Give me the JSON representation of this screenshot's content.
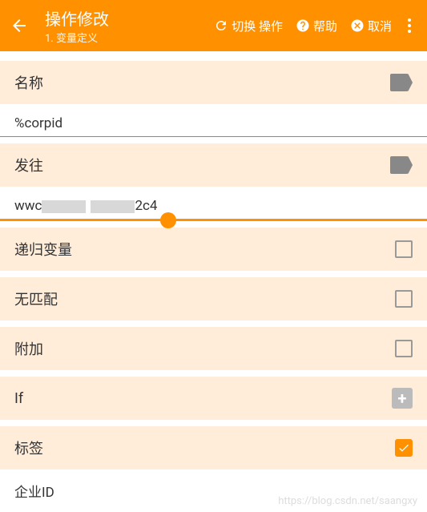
{
  "header": {
    "title": "操作修改",
    "subtitle": "1. 变量定义",
    "switch_action": "切换 操作",
    "help": "帮助",
    "cancel": "取消"
  },
  "sections": {
    "name": {
      "label": "名称",
      "value": "%corpid"
    },
    "to": {
      "label": "发往",
      "value_prefix": "wwc",
      "value_suffix": "2c4"
    },
    "recursive": {
      "label": "递归变量"
    },
    "nomatch": {
      "label": "无匹配"
    },
    "append": {
      "label": "附加"
    },
    "if": {
      "label": "If"
    },
    "tag": {
      "label": "标签"
    }
  },
  "bottom": {
    "label": "企业ID"
  },
  "watermark": "https://blog.csdn.net/saangxy"
}
